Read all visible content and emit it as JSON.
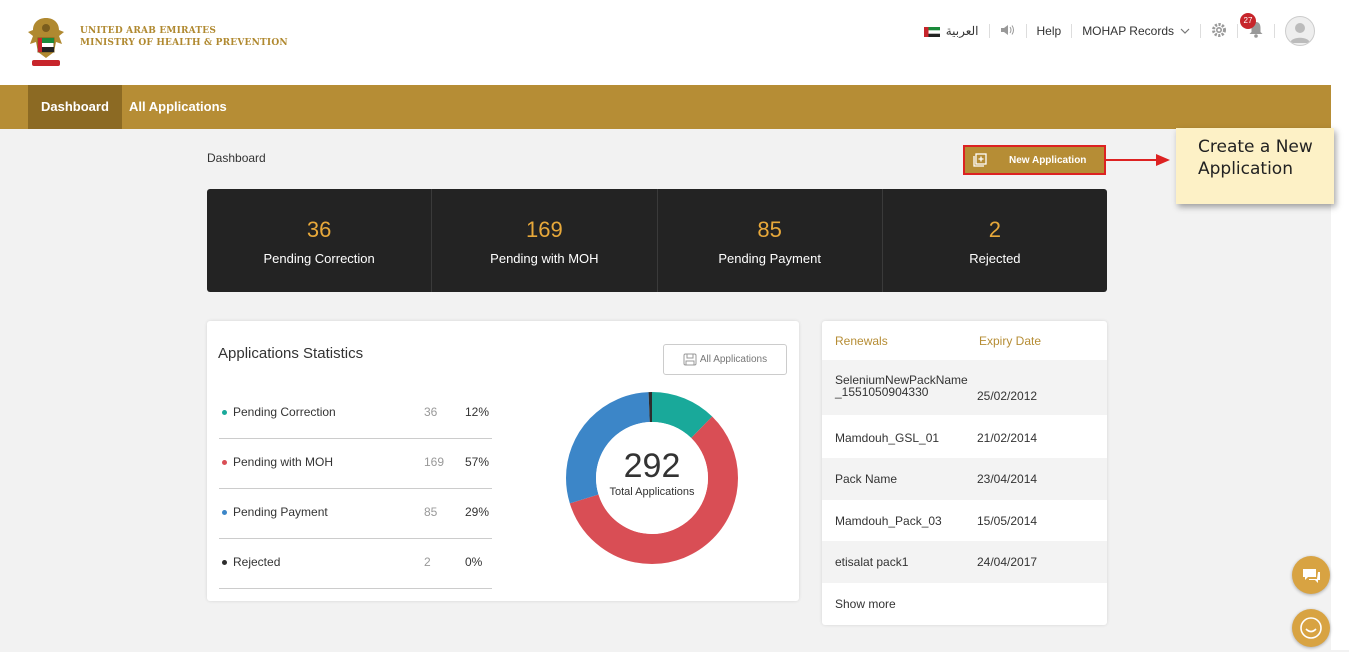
{
  "header": {
    "brand_line1": "UNITED ARAB EMIRATES",
    "brand_line2": "MINISTRY OF HEALTH & PREVENTION",
    "language_label": "العربية",
    "help_label": "Help",
    "records_menu_label": "MOHAP Records",
    "notification_count": "27"
  },
  "nav": {
    "items": [
      {
        "label": "Dashboard",
        "active": true
      },
      {
        "label": "All Applications",
        "active": false
      }
    ]
  },
  "page": {
    "breadcrumb": "Dashboard",
    "new_application_label": "New Application"
  },
  "callout": {
    "line1": "Create a New",
    "line2": "Application"
  },
  "summary": [
    {
      "value": "36",
      "label": "Pending Correction"
    },
    {
      "value": "169",
      "label": "Pending with MOH"
    },
    {
      "value": "85",
      "label": "Pending Payment"
    },
    {
      "value": "2",
      "label": "Rejected"
    }
  ],
  "statistics": {
    "title": "Applications Statistics",
    "all_applications_label": "All Applications",
    "rows": [
      {
        "name": "Pending Correction",
        "count": "36",
        "pct": "12%",
        "color": "#19a99a"
      },
      {
        "name": "Pending with MOH",
        "count": "169",
        "pct": "57%",
        "color": "#d94e55"
      },
      {
        "name": "Pending Payment",
        "count": "85",
        "pct": "29%",
        "color": "#3c86c8"
      },
      {
        "name": "Rejected",
        "count": "2",
        "pct": "0%",
        "color": "#2d2d2d"
      }
    ],
    "total": "292",
    "total_label": "Total Applications"
  },
  "chart_data": {
    "type": "pie",
    "categories": [
      "Pending Correction",
      "Pending with MOH",
      "Pending Payment",
      "Rejected"
    ],
    "values": [
      36,
      169,
      85,
      2
    ],
    "colors": [
      "#19a99a",
      "#d94e55",
      "#3c86c8",
      "#2d2d2d"
    ],
    "title": ""
  },
  "renewals": {
    "col_name": "Renewals",
    "col_date": "Expiry Date",
    "rows": [
      {
        "name": "SeleniumNewPackName _1551050904330",
        "date": "25/02/2012"
      },
      {
        "name": "Mamdouh_GSL_01",
        "date": "21/02/2014"
      },
      {
        "name": "Pack Name",
        "date": "23/04/2014"
      },
      {
        "name": "Mamdouh_Pack_03",
        "date": "15/05/2014"
      },
      {
        "name": "etisalat pack1",
        "date": "24/04/2017"
      }
    ],
    "show_more_label": "Show more"
  }
}
